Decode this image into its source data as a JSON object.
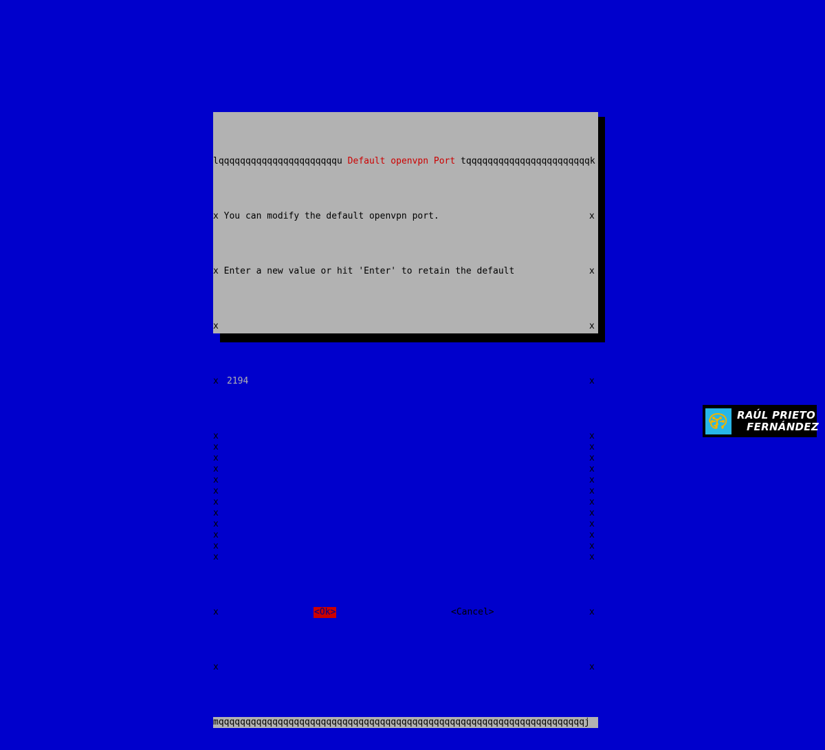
{
  "screen": {
    "background_color": "#0000cc",
    "type": "terminal-fullscreen"
  },
  "dialog": {
    "kind": "whiptail-inputbox",
    "title": "Default openvpn Port",
    "title_color": "#cc0000",
    "background_color": "#b2b2b2",
    "border": {
      "top_left_glyph": "l",
      "top_right_glyph": "k",
      "bottom_left_glyph": "m",
      "bottom_right_glyph": "j",
      "horizontal_glyph": "q",
      "vertical_glyph": "x",
      "title_left_join_glyph": "u",
      "title_right_join_glyph": "t",
      "top_left_run": "lqqqqqqqqqqqqqqqqqqqqqqu",
      "top_right_run": "tqqqqqqqqqqqqqqqqqqqqqqqk",
      "bottom_run": "mqqqqqqqqqqqqqqqqqqqqqqqqqqqqqqqqqqqqqqqqqqqqqqqqqqqqqqqqqqqqqqqqqqqqj"
    },
    "messages": [
      "You can modify the default openvpn port.",
      "Enter a new value or hit 'Enter' to retain the default"
    ],
    "input": {
      "value": "2194",
      "placeholder": "",
      "background_color": "#0000cc",
      "text_color": "#b2b2b2"
    },
    "buttons": [
      {
        "label": "<Ok>",
        "focused": true,
        "background_color": "#cc0000",
        "text_color": "#000088"
      },
      {
        "label": "<Cancel>",
        "focused": false,
        "background_color": "#b2b2b2",
        "text_color": "#000000"
      }
    ],
    "blank_rows_before_input": 1,
    "blank_rows_after_input": 12,
    "blank_rows_after_buttons": 1
  },
  "watermark": {
    "line1": "RAÚL PRIETO",
    "line2": "FERNÁNDEZ",
    "icon": "brain-circuit-icon",
    "icon_background_color": "#27b6e8",
    "icon_color": "#f0b400",
    "background_color": "#000000",
    "text_color": "#ffffff"
  }
}
